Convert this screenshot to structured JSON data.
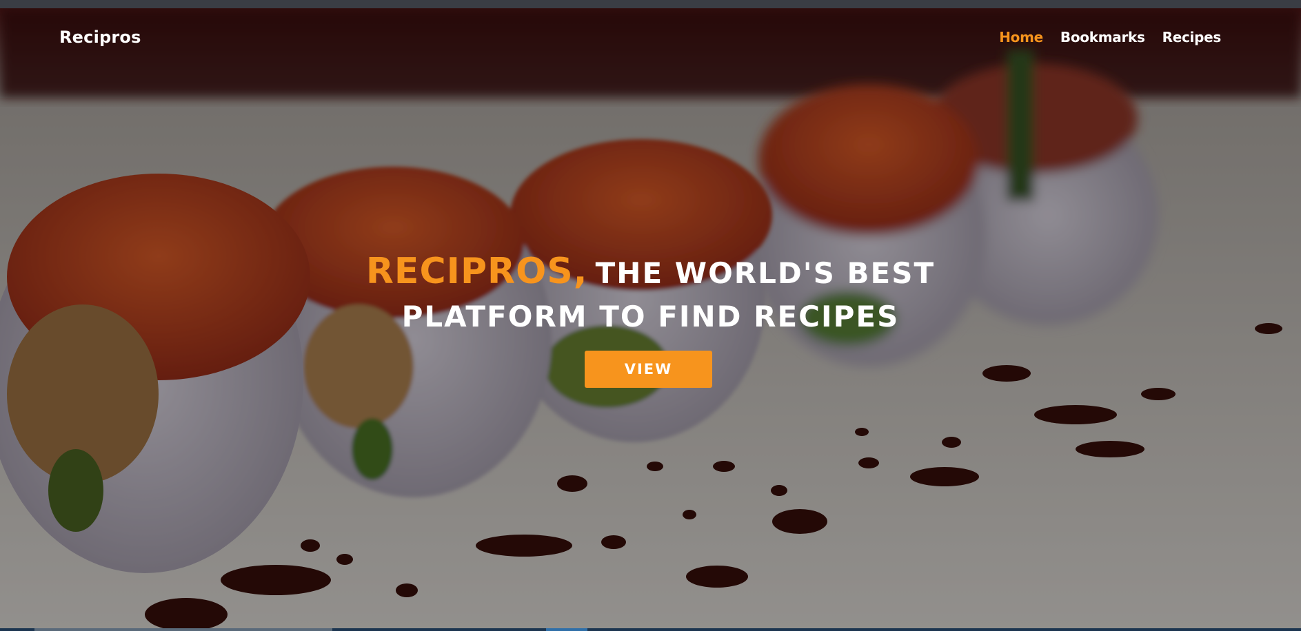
{
  "nav": {
    "brand": "Recipros",
    "links": [
      {
        "label": "Home",
        "active": true
      },
      {
        "label": "Bookmarks",
        "active": false
      },
      {
        "label": "Recipes",
        "active": false
      }
    ]
  },
  "hero": {
    "headline_brand": "RECIPROS,",
    "headline_line1_rest": "THE WORLD'S BEST",
    "headline_line2": "PLATFORM TO FIND RECIPES",
    "button_label": "VIEW",
    "background": "sushi-rolls-photo"
  },
  "colors": {
    "accent": "#f7941d",
    "text": "#ffffff"
  }
}
